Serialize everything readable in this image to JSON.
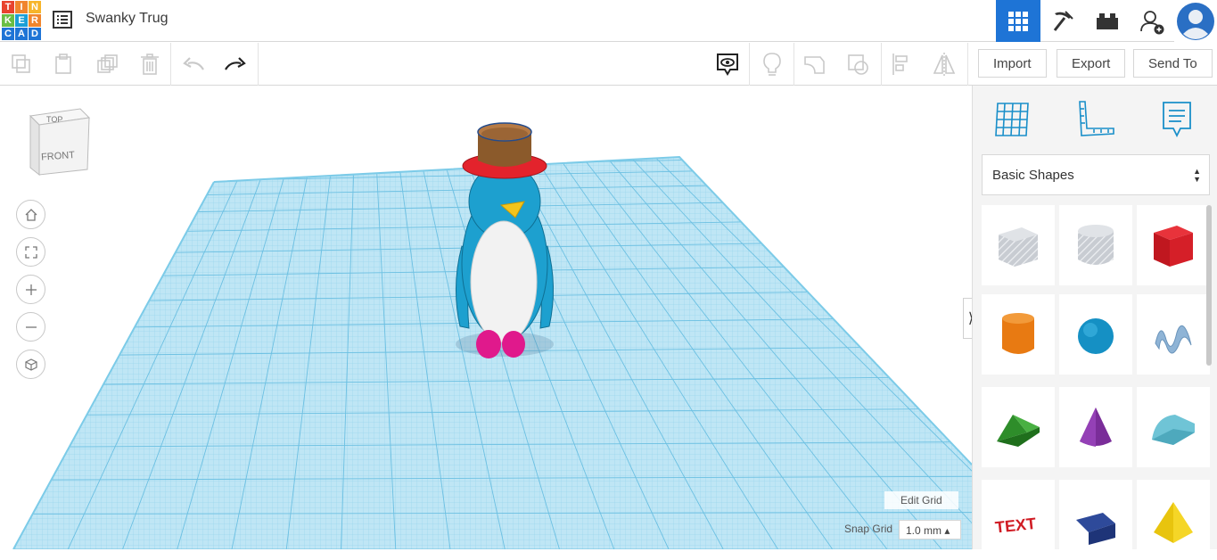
{
  "app": {
    "logo_letters": [
      "T",
      "I",
      "N",
      "K",
      "E",
      "R",
      "C",
      "A",
      "D"
    ],
    "logo_colors": [
      "#e8432e",
      "#e8432e",
      "#e8432e",
      "#1a9fd6",
      "#1a9fd6",
      "#1a9fd6",
      "#1a9fd6",
      "#1a9fd6",
      "#1a9fd6"
    ],
    "logo_text_colors": [
      "#e8432e",
      "#f0852d",
      "#f7b52a",
      "#6abe45",
      "#1a9fd6",
      "#1a9fd6",
      "#1e74d6",
      "#1e74d6",
      "#1e74d6"
    ],
    "design_title": "Swanky Trug"
  },
  "top_right": [
    "grid-view-icon",
    "pickaxe-icon",
    "brick-icon",
    "add-user-icon",
    "avatar-icon"
  ],
  "toolbar": {
    "import_label": "Import",
    "export_label": "Export",
    "send_to_label": "Send To"
  },
  "viewcube": {
    "top": "TOP",
    "front": "FRONT"
  },
  "grid": {
    "edit_grid_label": "Edit Grid",
    "snap_grid_label": "Snap Grid",
    "snap_value": "1.0 mm ▴"
  },
  "panel": {
    "shape_library": "Basic Shapes",
    "shapes": [
      "box-hole",
      "cylinder-hole",
      "box",
      "cylinder",
      "sphere",
      "scribble",
      "roof",
      "cone",
      "round-roof",
      "text",
      "wedge",
      "pyramid"
    ]
  },
  "colors": {
    "accent": "#1e74d6",
    "grid": "#a9dbef",
    "grid_line": "#68bfe2"
  }
}
